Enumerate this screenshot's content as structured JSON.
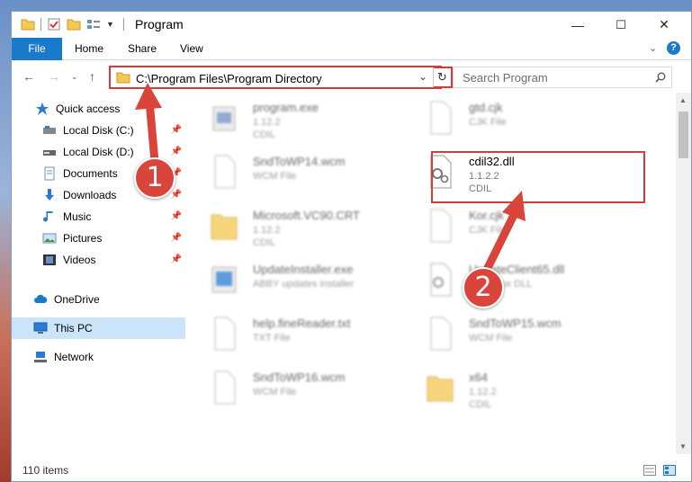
{
  "window": {
    "title": "Program",
    "minimize": "—",
    "maximize": "☐",
    "close": "✕"
  },
  "ribbon": {
    "tabs": [
      "File",
      "Home",
      "Share",
      "View"
    ]
  },
  "address": {
    "path": "C:\\Program Files\\Program Directory",
    "search_placeholder": "Search Program"
  },
  "nav": {
    "items": [
      {
        "label": "Quick access",
        "icon": "star-icon",
        "pinned": false
      },
      {
        "label": "Local Disk (C:)",
        "icon": "drive-icon",
        "pinned": true
      },
      {
        "label": "Local Disk (D:)",
        "icon": "drive-icon",
        "pinned": true
      },
      {
        "label": "Documents",
        "icon": "documents-icon",
        "pinned": true
      },
      {
        "label": "Downloads",
        "icon": "download-icon",
        "pinned": true
      },
      {
        "label": "Music",
        "icon": "music-icon",
        "pinned": true
      },
      {
        "label": "Pictures",
        "icon": "pictures-icon",
        "pinned": true
      },
      {
        "label": "Videos",
        "icon": "videos-icon",
        "pinned": true
      },
      {
        "label": "OneDrive",
        "icon": "cloud-icon",
        "pinned": false
      },
      {
        "label": "This PC",
        "icon": "computer-icon",
        "pinned": false
      },
      {
        "label": "Network",
        "icon": "network-icon",
        "pinned": false
      }
    ]
  },
  "files": [
    {
      "name": "program.exe",
      "line1": "1.12.2",
      "line2": "CDIL",
      "icon": "exe-icon"
    },
    {
      "name": "gtd.cjk",
      "line1": "CJK File",
      "line2": "",
      "icon": "file-icon"
    },
    {
      "name": "SndToWP14.wcm",
      "line1": "WCM File",
      "line2": "",
      "icon": "file-icon"
    },
    {
      "name": "cdil32.dll",
      "line1": "1.1.2.2",
      "line2": "CDIL",
      "icon": "dll-icon"
    },
    {
      "name": "Microsoft.VC90.CRT",
      "line1": "1.12.2",
      "line2": "CDIL",
      "icon": "folder-icon"
    },
    {
      "name": "Kor.cjk",
      "line1": "CJK File",
      "line2": "",
      "icon": "file-icon"
    },
    {
      "name": "UpdateInstaller.exe",
      "line1": "ABBY updates installer",
      "line2": "",
      "icon": "installer-icon"
    },
    {
      "name": "UpdateClient65.dll",
      "line1": "Resource DLL",
      "line2": "",
      "icon": "dll-icon"
    },
    {
      "name": "help.fineReader.txt",
      "line1": "TXT File",
      "line2": "",
      "icon": "file-icon"
    },
    {
      "name": "SndToWP15.wcm",
      "line1": "WCM File",
      "line2": "",
      "icon": "file-icon"
    },
    {
      "name": "SndToWP16.wcm",
      "line1": "WCM File",
      "line2": "",
      "icon": "file-icon"
    },
    {
      "name": "x64",
      "line1": "1.12.2",
      "line2": "CDIL",
      "icon": "folder-icon"
    }
  ],
  "status": {
    "count": "110 items"
  },
  "annotations": {
    "step1": "1",
    "step2": "2"
  },
  "colors": {
    "accent": "#1979ca",
    "highlight": "#d63a3a"
  }
}
